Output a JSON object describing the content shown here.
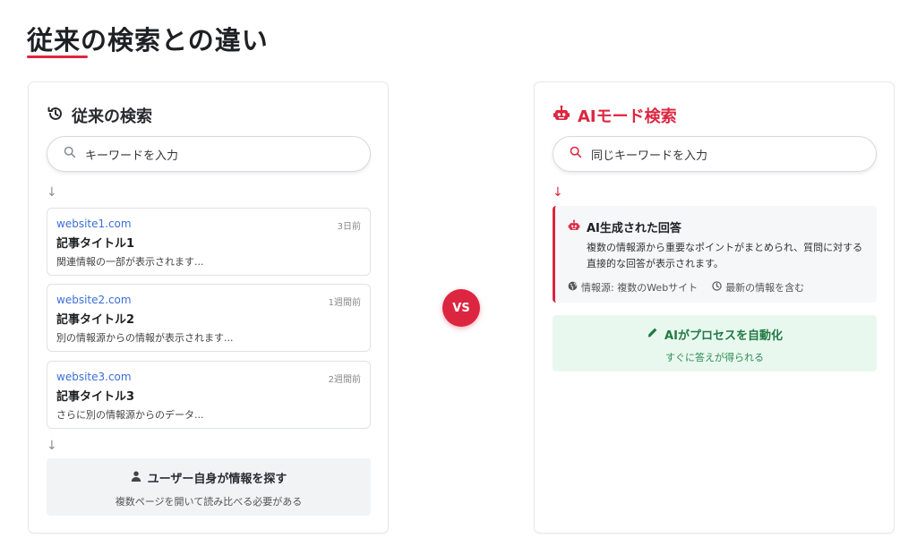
{
  "title": "従来の検索との違い",
  "colors": {
    "accent": "#dc2640",
    "link": "#3b6fd9",
    "success": "#217a45"
  },
  "left": {
    "heading": "従来の検索",
    "heading_icon": "history-icon",
    "search_placeholder": "キーワードを入力",
    "arrow": "↓",
    "results": [
      {
        "url": "website1.com",
        "time": "3日前",
        "title": "記事タイトル1",
        "snippet": "関連情報の一部が表示されます..."
      },
      {
        "url": "website2.com",
        "time": "1週間前",
        "title": "記事タイトル2",
        "snippet": "別の情報源からの情報が表示されます..."
      },
      {
        "url": "website3.com",
        "time": "2週間前",
        "title": "記事タイトル3",
        "snippet": "さらに別の情報源からのデータ..."
      }
    ],
    "user_box": {
      "title": "ユーザー自身が情報を探す",
      "subtitle": "複数ページを開いて読み比べる必要がある"
    }
  },
  "vs": "VS",
  "right": {
    "heading": "AIモード検索",
    "heading_icon": "robot-icon",
    "search_placeholder": "同じキーワードを入力",
    "arrow": "↓",
    "ai_answer": {
      "title": "AI生成された回答",
      "body": "複数の情報源から重要なポイントがまとめられ、質問に対する直接的な回答が表示されます。",
      "meta_sources": "情報源: 複数のWebサイト",
      "meta_latest": "最新の情報を含む"
    },
    "auto_box": {
      "title": "AIがプロセスを自動化",
      "subtitle": "すぐに答えが得られる"
    }
  }
}
